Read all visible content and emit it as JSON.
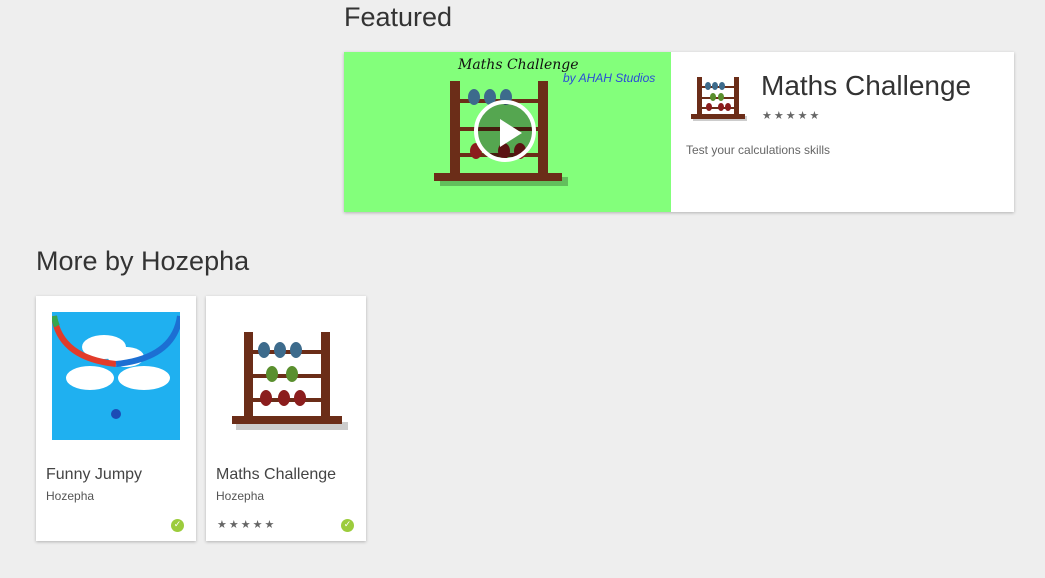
{
  "featured": {
    "section_title": "Featured",
    "promo_title": "Maths Challenge",
    "promo_by": "by AHAH Studios",
    "app_title": "Maths Challenge",
    "stars": "★★★★★",
    "description": "Test your calculations skills",
    "media_bg": "#83ff7b"
  },
  "more": {
    "section_title": "More by Hozepha",
    "cards": [
      {
        "title": "Funny Jumpy",
        "developer": "Hozepha",
        "stars": "",
        "check": "✓"
      },
      {
        "title": "Maths Challenge",
        "developer": "Hozepha",
        "stars": "★★★★★",
        "check": "✓"
      }
    ]
  }
}
